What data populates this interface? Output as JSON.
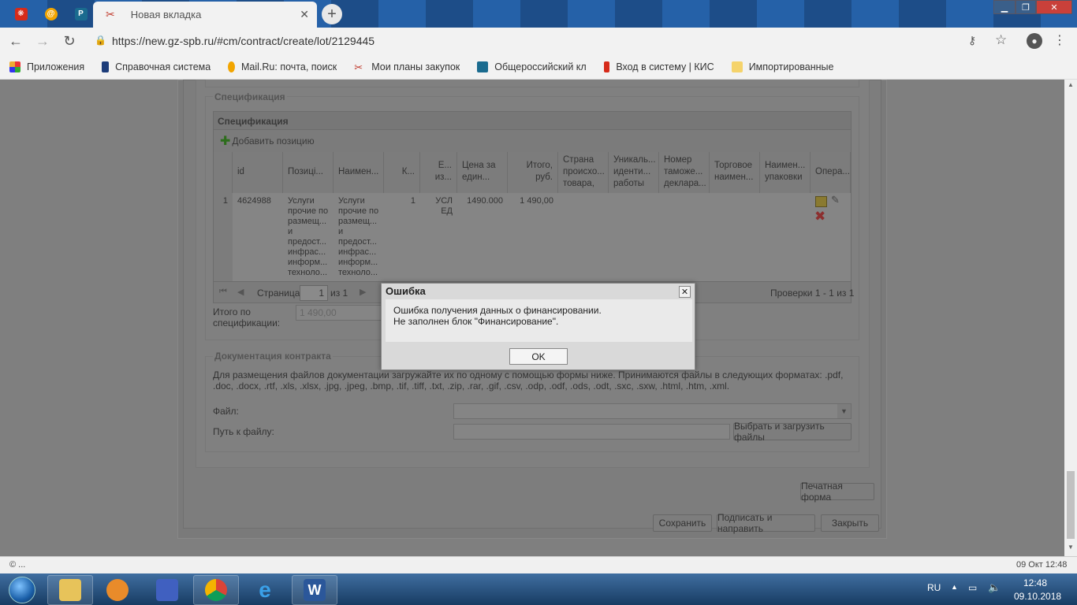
{
  "browser": {
    "active_tab_title": "Новая вкладка",
    "tab_close": "✕",
    "new_tab": "+",
    "url": "https://new.gz-spb.ru/#cm/contract/create/lot/2129445",
    "pinned_tabs": [
      {
        "icon": "kis-icon",
        "color": "#d62b1a",
        "glyph": "❋"
      },
      {
        "icon": "mailru-icon",
        "color": "#f2a500",
        "glyph": "@"
      },
      {
        "icon": "rz-icon",
        "color": "#1a6b8f",
        "glyph": "РЗ"
      }
    ],
    "bookmarks": [
      {
        "label": "Приложения",
        "icon": "apps-icon"
      },
      {
        "label": "Справочная система",
        "icon": "book-icon"
      },
      {
        "label": "Mail.Ru: почта, поиск",
        "icon": "mailru-icon"
      },
      {
        "label": "Мои планы закупок",
        "icon": "tools-icon"
      },
      {
        "label": "Общероссийский кл",
        "icon": "rz-icon"
      },
      {
        "label": "Вход в систему | КИС",
        "icon": "kis-icon"
      },
      {
        "label": "Импортированные",
        "icon": "folder-icon"
      }
    ]
  },
  "spec": {
    "fieldset_legend": "Спецификация",
    "grid_title": "Спецификация",
    "add_position": "Добавить позицию",
    "columns": [
      "id",
      "Позиці...",
      "Наимен...",
      "К...",
      "Е... из...",
      "Цена за един...",
      "Итого, руб.",
      "Страна происхо... товара, ...",
      "Уникаль... иденти... работы ...",
      "Номер таможе... деклара...",
      "Торговое наимен...",
      "Наимен... упаковки",
      "Опера..."
    ],
    "row": {
      "num": "1",
      "id": "4624988",
      "position": "Услуги прочие по размещ... и предост... инфрас... информ... техноло...",
      "name": "Услуги прочие по размещ... и предост... инфрас... информ... техноло...",
      "qty": "1",
      "unit": "УСЛ ЕД",
      "price": "1490.000",
      "total": "1 490,00"
    },
    "pager": {
      "page_label": "Страница",
      "page_value": "1",
      "of_label": "из 1",
      "summary": "Проверки 1 - 1 из 1"
    },
    "total_label": "Итого по спецификации:",
    "total_value": "1 490,00"
  },
  "docs": {
    "legend": "Документация контракта",
    "hint": "Для размещения файлов документации загружайте их по одному с помощью формы ниже. Принимаются файлы в следующих форматах: .pdf, .doc, .docx, .rtf, .xls, .xlsx, .jpg, .jpeg, .bmp, .tif, .tiff, .txt, .zip, .rar, .gif, .csv, .odp, .odf, .ods, .odt, .sxc, .sxw, .html, .htm, .xml.",
    "file_label": "Файл:",
    "path_label": "Путь к файлу:",
    "upload_button": "Выбрать и загрузить файлы"
  },
  "actions": {
    "print": "Печатная форма",
    "save": "Сохранить",
    "sign_send": "Подписать и направить",
    "close": "Закрыть"
  },
  "dialog": {
    "title": "Ошибка",
    "line1": "Ошибка получения данных о финансировании.",
    "line2": "Не заполнен блок \"Финансирование\".",
    "ok": "OK"
  },
  "statusbar": {
    "left": "© ...",
    "right": "09 Окт 12:48"
  },
  "taskbar": {
    "lang": "RU",
    "time": "12:48",
    "date": "09.10.2018",
    "apps": [
      "explorer-icon",
      "media-player-icon",
      "storage-icon",
      "chrome-icon",
      "ie-icon",
      "word-icon"
    ]
  }
}
